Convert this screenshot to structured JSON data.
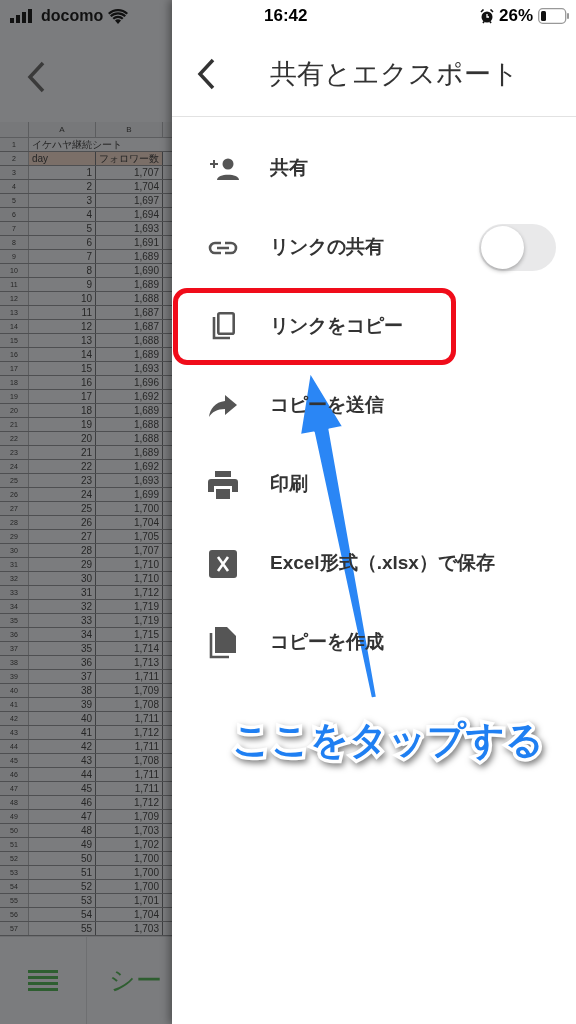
{
  "status_bar": {
    "carrier": "docomo",
    "time": "16:42",
    "battery": "26%"
  },
  "spreadsheet": {
    "columns": [
      "A",
      "B"
    ],
    "rows": [
      {
        "number": "1",
        "cells": [
          "イケハヤ継続シート"
        ],
        "kind": "title"
      },
      {
        "number": "2",
        "cells": [
          "day",
          "フォロワー数"
        ],
        "kind": "header"
      },
      {
        "number": "3",
        "cells": [
          "1",
          "1,707"
        ]
      },
      {
        "number": "4",
        "cells": [
          "2",
          "1,704"
        ]
      },
      {
        "number": "5",
        "cells": [
          "3",
          "1,697"
        ]
      },
      {
        "number": "6",
        "cells": [
          "4",
          "1,694"
        ]
      },
      {
        "number": "7",
        "cells": [
          "5",
          "1,693"
        ]
      },
      {
        "number": "8",
        "cells": [
          "6",
          "1,691"
        ]
      },
      {
        "number": "9",
        "cells": [
          "7",
          "1,689"
        ]
      },
      {
        "number": "10",
        "cells": [
          "8",
          "1,690"
        ]
      },
      {
        "number": "11",
        "cells": [
          "9",
          "1,689"
        ]
      },
      {
        "number": "12",
        "cells": [
          "10",
          "1,688"
        ]
      },
      {
        "number": "13",
        "cells": [
          "11",
          "1,687"
        ]
      },
      {
        "number": "14",
        "cells": [
          "12",
          "1,687"
        ]
      },
      {
        "number": "15",
        "cells": [
          "13",
          "1,688"
        ]
      },
      {
        "number": "16",
        "cells": [
          "14",
          "1,689"
        ]
      },
      {
        "number": "17",
        "cells": [
          "15",
          "1,693"
        ]
      },
      {
        "number": "18",
        "cells": [
          "16",
          "1,696"
        ]
      },
      {
        "number": "19",
        "cells": [
          "17",
          "1,692"
        ]
      },
      {
        "number": "20",
        "cells": [
          "18",
          "1,689"
        ]
      },
      {
        "number": "21",
        "cells": [
          "19",
          "1,688"
        ]
      },
      {
        "number": "22",
        "cells": [
          "20",
          "1,688"
        ]
      },
      {
        "number": "23",
        "cells": [
          "21",
          "1,689"
        ]
      },
      {
        "number": "24",
        "cells": [
          "22",
          "1,692"
        ]
      },
      {
        "number": "25",
        "cells": [
          "23",
          "1,693"
        ]
      },
      {
        "number": "26",
        "cells": [
          "24",
          "1,699"
        ]
      },
      {
        "number": "27",
        "cells": [
          "25",
          "1,700"
        ]
      },
      {
        "number": "28",
        "cells": [
          "26",
          "1,704"
        ]
      },
      {
        "number": "29",
        "cells": [
          "27",
          "1,705"
        ]
      },
      {
        "number": "30",
        "cells": [
          "28",
          "1,707"
        ]
      },
      {
        "number": "31",
        "cells": [
          "29",
          "1,710"
        ]
      },
      {
        "number": "32",
        "cells": [
          "30",
          "1,710"
        ]
      },
      {
        "number": "33",
        "cells": [
          "31",
          "1,712"
        ]
      },
      {
        "number": "34",
        "cells": [
          "32",
          "1,719"
        ]
      },
      {
        "number": "35",
        "cells": [
          "33",
          "1,719"
        ]
      },
      {
        "number": "36",
        "cells": [
          "34",
          "1,715"
        ]
      },
      {
        "number": "37",
        "cells": [
          "35",
          "1,714"
        ]
      },
      {
        "number": "38",
        "cells": [
          "36",
          "1,713"
        ]
      },
      {
        "number": "39",
        "cells": [
          "37",
          "1,711"
        ]
      },
      {
        "number": "40",
        "cells": [
          "38",
          "1,709"
        ]
      },
      {
        "number": "41",
        "cells": [
          "39",
          "1,708"
        ]
      },
      {
        "number": "42",
        "cells": [
          "40",
          "1,711"
        ]
      },
      {
        "number": "43",
        "cells": [
          "41",
          "1,712"
        ]
      },
      {
        "number": "44",
        "cells": [
          "42",
          "1,711"
        ]
      },
      {
        "number": "45",
        "cells": [
          "43",
          "1,708"
        ]
      },
      {
        "number": "46",
        "cells": [
          "44",
          "1,711"
        ]
      },
      {
        "number": "47",
        "cells": [
          "45",
          "1,711"
        ]
      },
      {
        "number": "48",
        "cells": [
          "46",
          "1,712"
        ]
      },
      {
        "number": "49",
        "cells": [
          "47",
          "1,709"
        ]
      },
      {
        "number": "50",
        "cells": [
          "48",
          "1,703"
        ]
      },
      {
        "number": "51",
        "cells": [
          "49",
          "1,702"
        ]
      },
      {
        "number": "52",
        "cells": [
          "50",
          "1,700"
        ]
      },
      {
        "number": "53",
        "cells": [
          "51",
          "1,700"
        ]
      },
      {
        "number": "54",
        "cells": [
          "52",
          "1,700"
        ]
      },
      {
        "number": "55",
        "cells": [
          "53",
          "1,701"
        ]
      },
      {
        "number": "56",
        "cells": [
          "54",
          "1,704"
        ]
      },
      {
        "number": "57",
        "cells": [
          "55",
          "1,703"
        ]
      }
    ]
  },
  "sheet_bar": {
    "label": "シー"
  },
  "drawer": {
    "title": "共有とエクスポート",
    "items": [
      {
        "label": "共有",
        "highlighted": false
      },
      {
        "label": "リンクの共有",
        "kind": "toggle",
        "on": false,
        "highlighted": false
      },
      {
        "label": "リンクをコピー",
        "highlighted": true
      },
      {
        "label": "コピーを送信",
        "highlighted": false
      },
      {
        "label": "印刷",
        "highlighted": false
      },
      {
        "label": "Excel形式（.xlsx）で保存",
        "highlighted": false
      },
      {
        "label": "コピーを作成",
        "highlighted": false
      }
    ]
  },
  "annotation": {
    "text": "ここをタップする"
  }
}
